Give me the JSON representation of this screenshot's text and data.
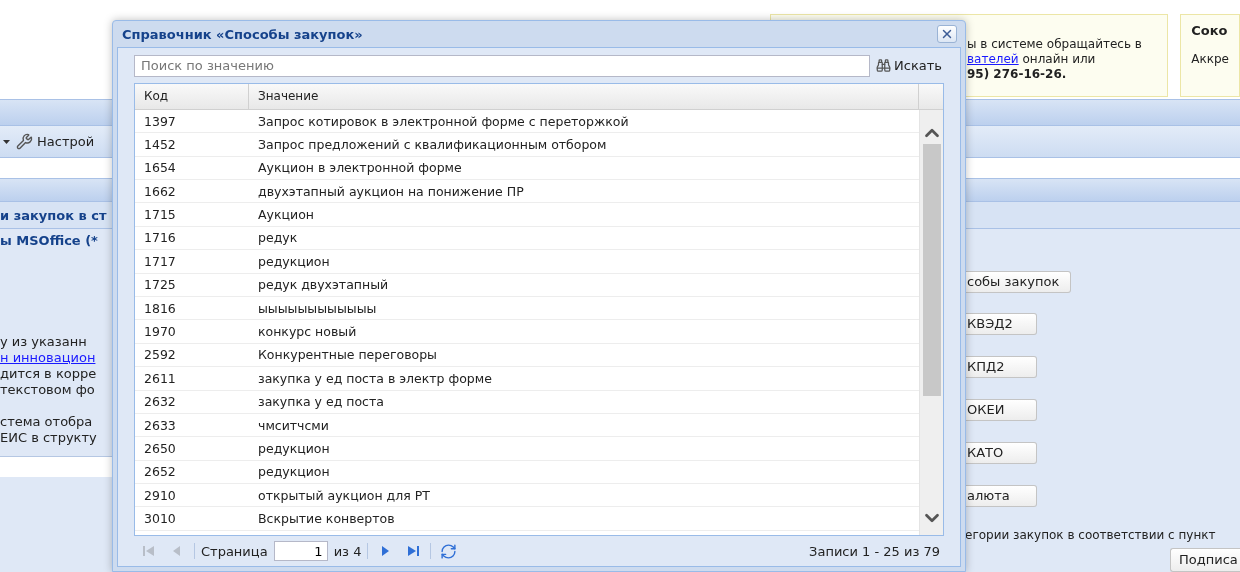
{
  "background": {
    "notice": {
      "lines": [
        {
          "text": "ы в системе обращайтесь в",
          "bold": false
        },
        {
          "link": "вателей",
          "text": " онлайн или",
          "bold": false
        },
        {
          "text": "95) 276-16-26.",
          "bold": true
        }
      ]
    },
    "notice_2": {
      "title": "Соко",
      "text": "Аккре"
    },
    "toolbar": {
      "label": "Настрой"
    },
    "section_title": "и закупок в ст",
    "panel": {
      "title": "ы MSOffice (*",
      "lines": [
        {
          "text": "у из указанн",
          "link": false
        },
        {
          "text": "н инновацион",
          "link": true
        },
        {
          "text": "дится в корре",
          "link": false
        },
        {
          "text": "текстовом фо",
          "link": false
        },
        {
          "text": "стема отобра",
          "link": false
        },
        {
          "text": "ЕИС в структу",
          "link": false
        }
      ]
    },
    "buttons": [
      "собы закупок",
      "КВЭД2",
      "КПД2",
      "ОКЕИ",
      "КАТО",
      "алюта"
    ],
    "footer_text": "егории закупок в соответствии с пункт",
    "sign_button": "Подписа"
  },
  "dialog": {
    "title": "Справочник «Способы закупок»",
    "search": {
      "placeholder": "Поиск по значению",
      "button": "Искать"
    },
    "table": {
      "columns": [
        "Код",
        "Значение"
      ],
      "rows": [
        [
          "1397",
          "Запрос котировок в электронной форме с переторжкой"
        ],
        [
          "1452",
          "Запрос предложений с квалификационным отбором"
        ],
        [
          "1654",
          "Аукцион в электронной форме"
        ],
        [
          "1662",
          "двухэтапный аукцион на понижение ПР"
        ],
        [
          "1715",
          "Аукцион"
        ],
        [
          "1716",
          "редук"
        ],
        [
          "1717",
          "редукцион"
        ],
        [
          "1725",
          "редук двухэтапный"
        ],
        [
          "1816",
          "ыыыыыыыыыыыы"
        ],
        [
          "1970",
          "конкурс новый"
        ],
        [
          "2592",
          "Конкурентные переговоры"
        ],
        [
          "2611",
          "закупка у ед поста в электр форме"
        ],
        [
          "2632",
          "закупка у ед поста"
        ],
        [
          "2633",
          "чмситчсми"
        ],
        [
          "2650",
          "редукцион"
        ],
        [
          "2652",
          "редукцион"
        ],
        [
          "2910",
          "открытый аукцион для РТ"
        ],
        [
          "3010",
          "Вскрытие конвертов"
        ]
      ]
    },
    "pager": {
      "buttons_before": [
        {
          "kind": "first",
          "disabled": true
        },
        {
          "kind": "prev",
          "disabled": true
        }
      ],
      "page_label": "Страница",
      "page": "1",
      "page_total": "из 4",
      "buttons_after": [
        {
          "kind": "next",
          "disabled": false
        },
        {
          "kind": "last",
          "disabled": false
        }
      ],
      "summary": "Записи 1 - 25 из 79"
    }
  }
}
